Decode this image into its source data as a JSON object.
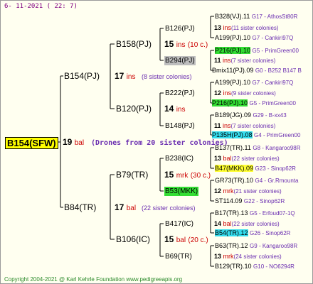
{
  "date": "6- 11-2021 ( 22: 7)",
  "root": {
    "label": "B154(SFW)",
    "number": "19",
    "sub": "bal",
    "note": "(Drones from 20 sister colonies)"
  },
  "gen1": [
    {
      "label": "B154(PJ)",
      "number": "17",
      "sub": "ins",
      "note": "(8 sister colonies)"
    },
    {
      "label": "B84(TR)",
      "number": "17",
      "sub": "bal",
      "note": "(22 sister colonies)"
    }
  ],
  "gen2": [
    {
      "label": "B158(PJ)",
      "number": "15",
      "sub": "ins",
      "note": "(10 c.)"
    },
    {
      "label": "B120(PJ)",
      "number": "14",
      "sub": "ins",
      "note": ""
    },
    {
      "label": "B79(TR)",
      "number": "15",
      "sub": "mrk",
      "note": "(30 c.)"
    },
    {
      "label": "B106(IC)",
      "number": "15",
      "sub": "bal",
      "note": "(20 c.)"
    }
  ],
  "gen3": [
    {
      "label": "B126(PJ)"
    },
    {
      "label": "B294(PJ)"
    },
    {
      "label": "B222(PJ)"
    },
    {
      "label": "B148(PJ)"
    },
    {
      "label": "B238(IC)"
    },
    {
      "label": "B53(MKK)"
    },
    {
      "label": "B417(IC)"
    },
    {
      "label": "B69(TR)"
    }
  ],
  "gen4": [
    {
      "label": "B328(VJ).11",
      "note": "G17 - AthosSt80R"
    },
    {
      "number": "13",
      "sub": "ins",
      "note": "(11 sister colonies)"
    },
    {
      "label": "A199(PJ).10",
      "note": "G7 - Cankiri97Q"
    },
    {
      "label": "P216(PJ).10",
      "note": "G5 - PrimGreen00"
    },
    {
      "number": "11",
      "sub": "ins",
      "note": "(7 sister colonies)"
    },
    {
      "label": "Bmix11(PJ).09",
      "note": "G0 - B252 B147 B"
    },
    {
      "label": "A199(PJ).10",
      "note": "G7 - Cankiri97Q"
    },
    {
      "number": "12",
      "sub": "ins",
      "note": "(9 sister colonies)"
    },
    {
      "label": "P216(PJ).10",
      "note": "G5 - PrimGreen00"
    },
    {
      "label": "B189(JG).09",
      "note": "G29 - B-xx43"
    },
    {
      "number": "11",
      "sub": "ins",
      "note": "(7 sister colonies)"
    },
    {
      "label": "P135H(PJ).08",
      "note": "G4 - PrimGreen00"
    },
    {
      "label": "B137(TR).11",
      "note": "G8 - Kangaroo98R"
    },
    {
      "number": "13",
      "sub": "bal",
      "note": "(22 sister colonies)"
    },
    {
      "label": "B47(MKK).09",
      "note": "G23 - Sinop62R"
    },
    {
      "label": "GR73(TR).10",
      "note": "G4 - Gr.Rmounta"
    },
    {
      "number": "12",
      "sub": "mrk",
      "note": "(21 sister colonies)"
    },
    {
      "label": "ST114.09",
      "note": "G22 - Sinop62R"
    },
    {
      "label": "B17(TR).13",
      "note": "G5 - Erfoud07-1Q"
    },
    {
      "number": "14",
      "sub": "bal",
      "note": "(22 sister colonies)"
    },
    {
      "label": "B54(TR).12",
      "note": "G26 - Sinop62R"
    },
    {
      "label": "B63(TR).12",
      "note": "G9 - Kangaroo98R"
    },
    {
      "number": "13",
      "sub": "mrk",
      "note": "(24 sister colonies)"
    },
    {
      "label": "B129(TR).10",
      "note": "G10 - NO6294R"
    }
  ],
  "copyright": "Copyright 2004-2021 @ Karl Kehrle Foundation    www.pedigreeapis.org"
}
